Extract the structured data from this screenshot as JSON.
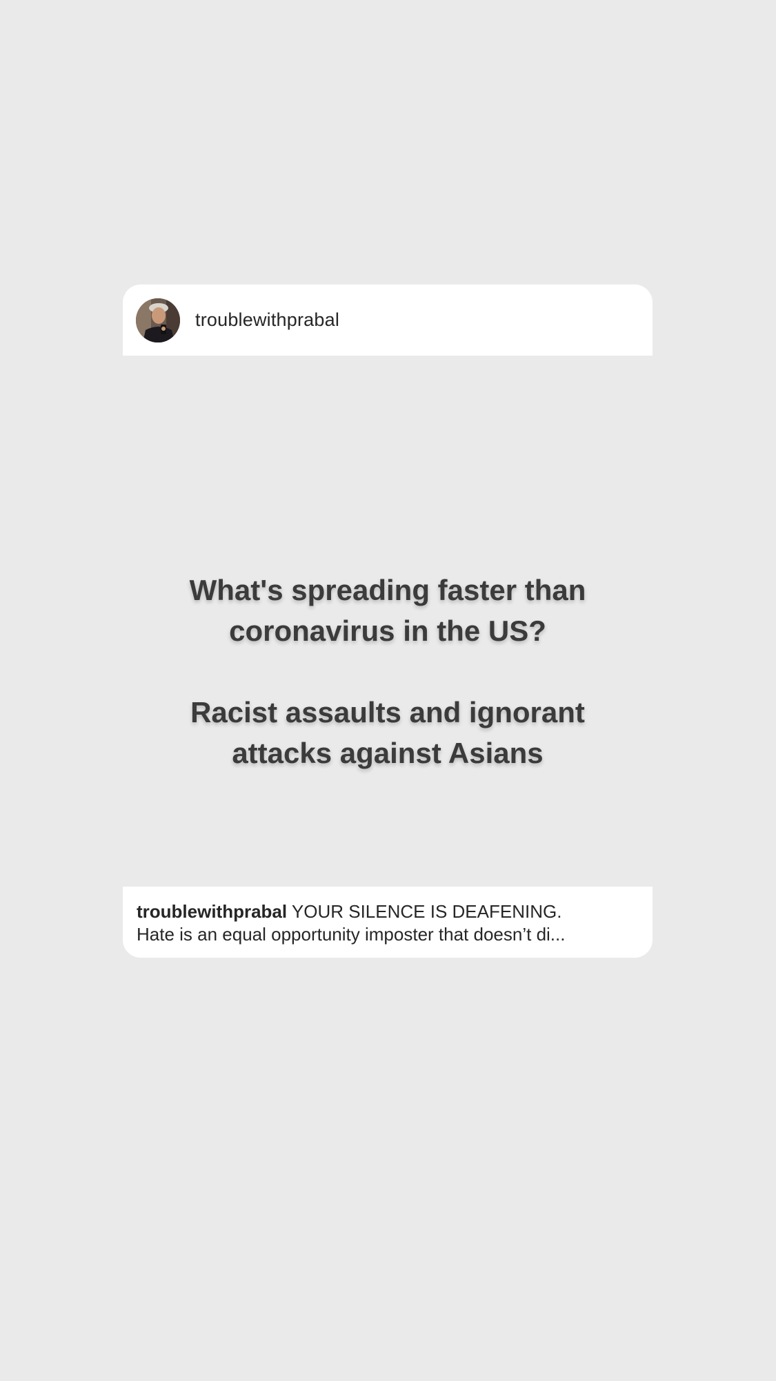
{
  "post": {
    "username": "troublewithprabal",
    "avatar_icon": "profile-photo-avatar",
    "headline": {
      "line1": "What's spreading faster than",
      "line2": "coronavirus in the US?",
      "line3": "Racist assaults and ignorant",
      "line4": "attacks against Asians"
    },
    "caption": {
      "username": "troublewithprabal",
      "text_line1": "YOUR SILENCE IS DEAFENING.",
      "text_line2": "Hate is an equal opportunity imposter that doesn’t di..."
    }
  },
  "colors": {
    "background": "#eaeaea",
    "card": "#ffffff",
    "text": "#262626",
    "headline": "#3b3b3b"
  }
}
